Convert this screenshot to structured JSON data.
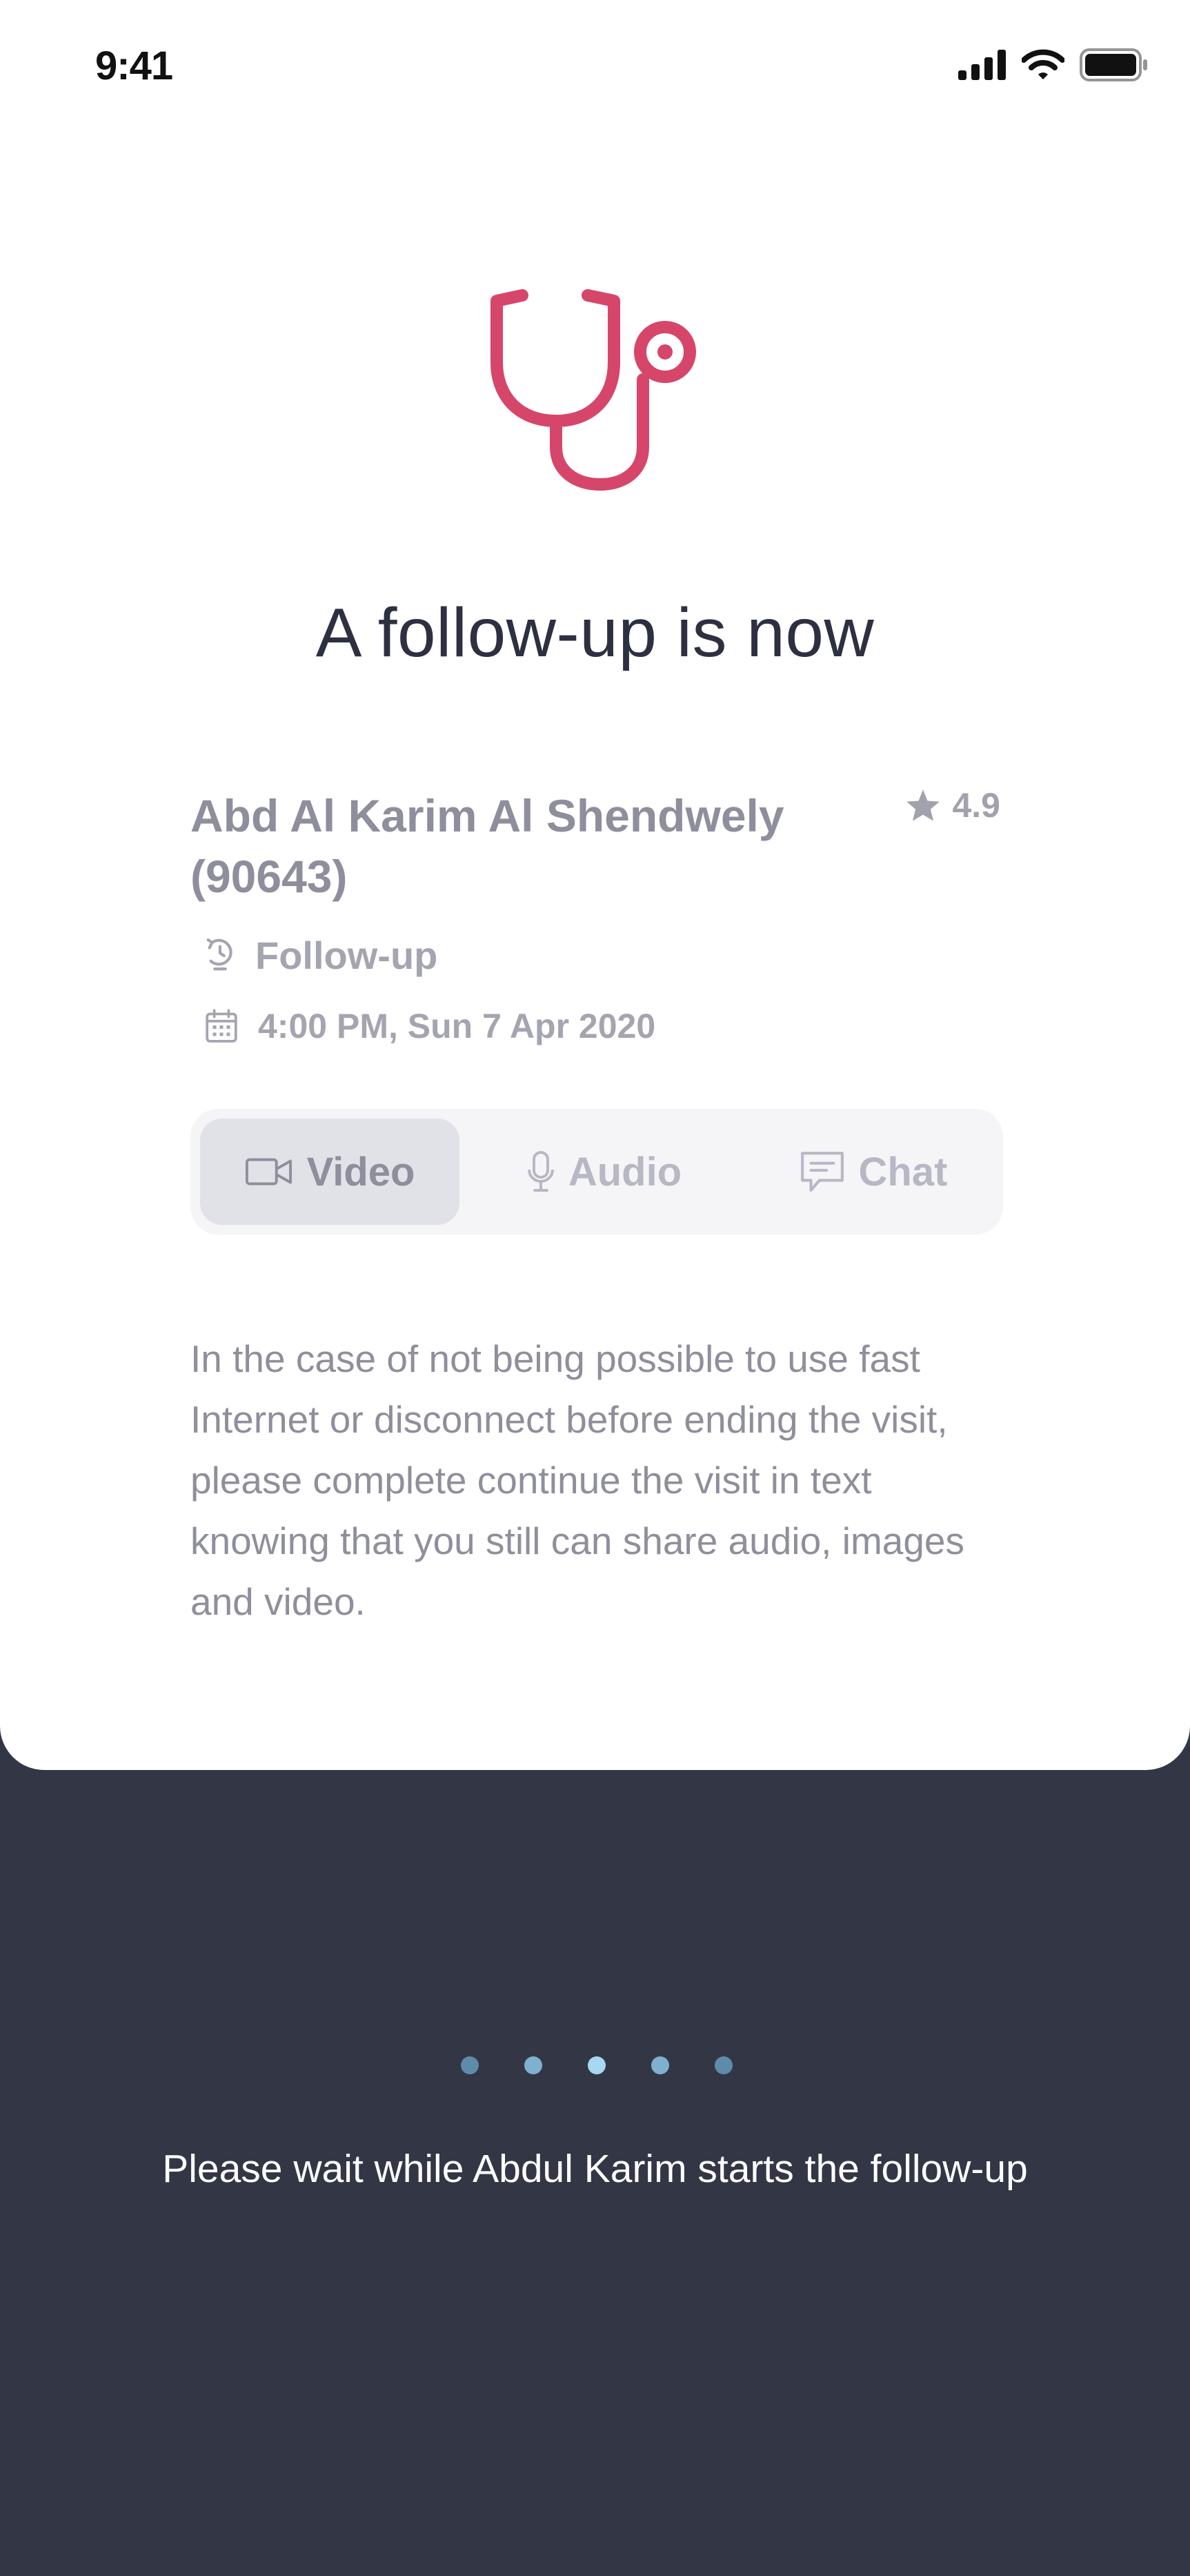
{
  "status_bar": {
    "time": "9:41",
    "icons": [
      "cellular-signal-icon",
      "wifi-icon",
      "battery-icon"
    ]
  },
  "hero": {
    "icon": "stethoscope-icon",
    "icon_color": "#D6466A",
    "title": "A follow-up is now"
  },
  "doctor": {
    "name_line1": "Abd Al Karim Al Shendwely",
    "name_line2": "(90643)",
    "rating": "4.9",
    "rating_icon": "star-icon",
    "visit_type": "Follow-up",
    "visit_type_icon": "follow-up-icon",
    "datetime": "4:00 PM, Sun 7 Apr 2020",
    "datetime_icon": "calendar-icon"
  },
  "modes": {
    "selected": "Video",
    "items": [
      {
        "label": "Video",
        "icon": "video-camera-icon"
      },
      {
        "label": "Audio",
        "icon": "microphone-icon"
      },
      {
        "label": "Chat",
        "icon": "chat-bubble-icon"
      }
    ]
  },
  "notice": "In the case of not being possible to use fast Internet or disconnect before ending the visit, please complete continue the visit in text knowing that you still can share audio, images and video.",
  "loading": {
    "dot_colors": [
      "#5E8BAA",
      "#7FB0CF",
      "#A8D8F0",
      "#7FB0CF",
      "#5E8BAA"
    ],
    "message": "Please wait while Abdul Karim starts the follow-up"
  },
  "colors": {
    "background_dark": "#333745",
    "card": "#FFFFFF",
    "accent": "#D6466A"
  }
}
